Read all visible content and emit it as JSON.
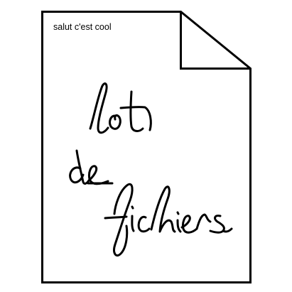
{
  "document": {
    "caption": "salut c'est cool",
    "handwritten_lines": [
      "lot",
      "de",
      "fichiers"
    ]
  },
  "colors": {
    "ink": "#000000",
    "paper": "#ffffff"
  },
  "icon": "document-page-icon"
}
